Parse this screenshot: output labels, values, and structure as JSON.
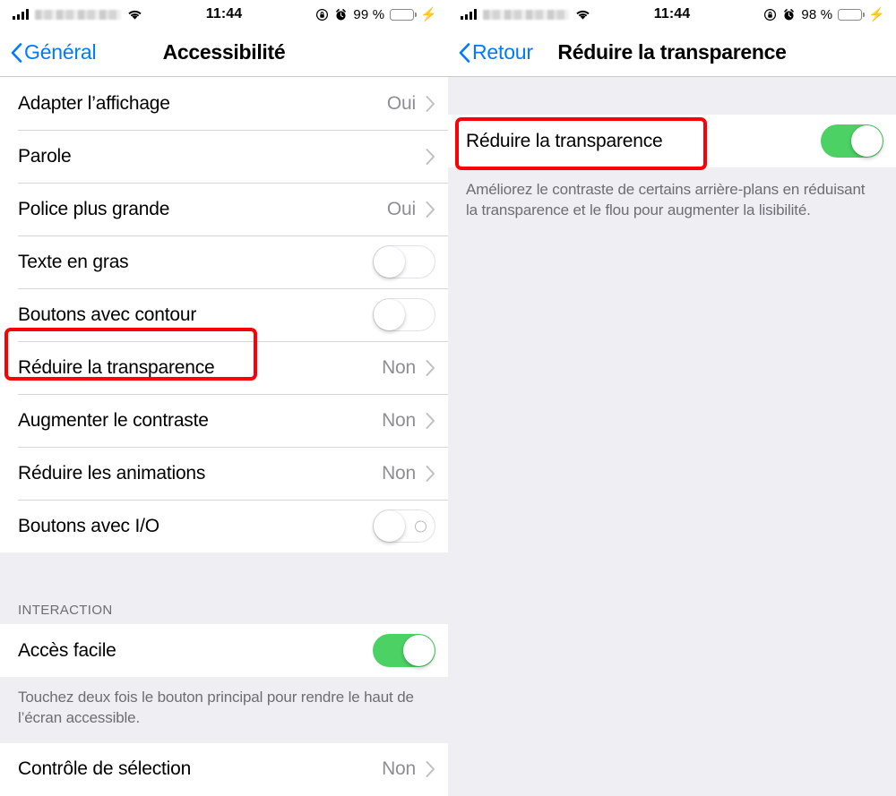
{
  "left": {
    "status_bar": {
      "signal_icon": "cellular-bars-icon",
      "carrier": "",
      "wifi_icon": "wifi-icon",
      "time": "11:44",
      "rotation_lock_icon": "rotation-lock-icon",
      "alarm_icon": "alarm-clock-icon",
      "battery_percent": "99 %",
      "battery_icon": "battery-icon",
      "charging_icon": "lightning-bolt-icon"
    },
    "nav": {
      "back_label": "Général",
      "back_icon": "chevron-left-icon",
      "title": "Accessibilité"
    },
    "rows_top": [
      {
        "label": "Adapter l’affichage",
        "value": "Oui",
        "control": "disclosure"
      },
      {
        "label": "Parole",
        "value": "",
        "control": "disclosure"
      },
      {
        "label": "Police plus grande",
        "value": "Oui",
        "control": "disclosure"
      },
      {
        "label": "Texte en gras",
        "value": "",
        "control": "toggle-off"
      },
      {
        "label": "Boutons avec contour",
        "value": "",
        "control": "toggle-off"
      },
      {
        "label": "Réduire la transparence",
        "value": "Non",
        "control": "disclosure"
      },
      {
        "label": "Augmenter le contraste",
        "value": "Non",
        "control": "disclosure"
      },
      {
        "label": "Réduire les animations",
        "value": "Non",
        "control": "disclosure"
      },
      {
        "label": "Boutons avec I/O",
        "value": "",
        "control": "toggle-off-io"
      }
    ],
    "section": {
      "header": "INTERACTION",
      "rows": [
        {
          "label": "Accès facile",
          "value": "",
          "control": "toggle-on"
        }
      ],
      "footer": "Touchez deux fois le bouton principal pour rendre le haut de l’écran accessible."
    },
    "rows_bottom": [
      {
        "label": "Contrôle de sélection",
        "value": "Non",
        "control": "disclosure"
      }
    ]
  },
  "right": {
    "status_bar": {
      "signal_icon": "cellular-bars-icon",
      "carrier": "",
      "wifi_icon": "wifi-icon",
      "time": "11:44",
      "rotation_lock_icon": "rotation-lock-icon",
      "alarm_icon": "alarm-clock-icon",
      "battery_percent": "98 %",
      "battery_icon": "battery-icon",
      "charging_icon": "lightning-bolt-icon"
    },
    "nav": {
      "back_label": "Retour",
      "back_icon": "chevron-left-icon",
      "title": "Réduire la transparence"
    },
    "rows": [
      {
        "label": "Réduire la transparence",
        "value": "",
        "control": "toggle-on"
      }
    ],
    "footer": "Améliorez le contraste de certains arrière-plans en réduisant la transparence et le flou pour augmenter la lisibilité."
  },
  "colors": {
    "accent_blue": "#007aff",
    "toggle_green": "#4cd264",
    "highlight_red": "#fb0007",
    "group_background": "#efeef3",
    "secondary_text": "#8e8e93"
  }
}
